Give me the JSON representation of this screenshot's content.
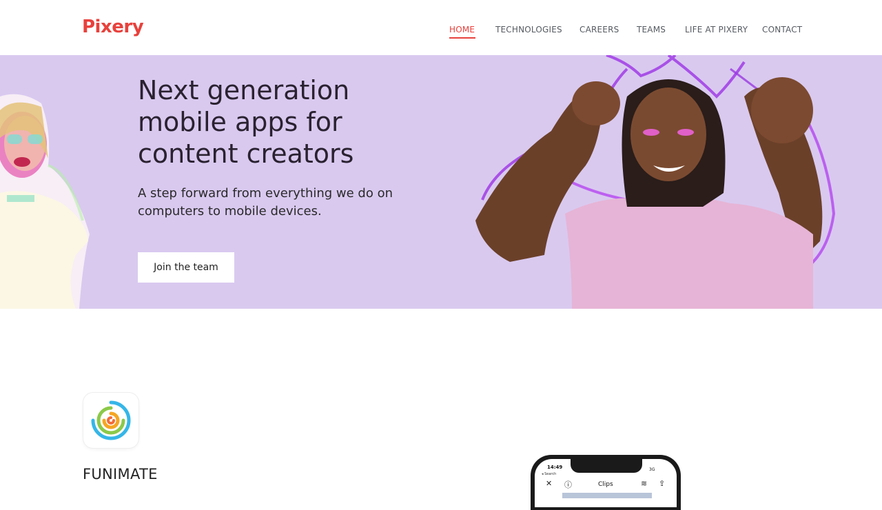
{
  "brand": {
    "logo_text": "Pixery",
    "accent_color": "#e8413c"
  },
  "nav": {
    "items": [
      {
        "label": "HOME",
        "active": true
      },
      {
        "label": "TECHNOLOGIES",
        "active": false
      },
      {
        "label": "CAREERS",
        "active": false
      },
      {
        "label": "TEAMS",
        "active": false
      },
      {
        "label": "LIFE AT PIXERY",
        "active": false
      },
      {
        "label": "CONTACT",
        "active": false
      }
    ]
  },
  "hero": {
    "title": "Next generation mobile apps for content creators",
    "subtitle": "A step forward from everything we do on computers to mobile devices.",
    "cta_label": "Join the team",
    "background_color": "#d9c9ef"
  },
  "app_section": {
    "app_name": "FUNIMATE",
    "icon": "funimate-spiral-icon",
    "phone": {
      "time": "14:49",
      "signal": "3G",
      "back_label": "◂ Search",
      "screen_title": "Clips",
      "icons": [
        "close-icon",
        "help-icon",
        "layers-icon",
        "share-icon"
      ]
    }
  }
}
